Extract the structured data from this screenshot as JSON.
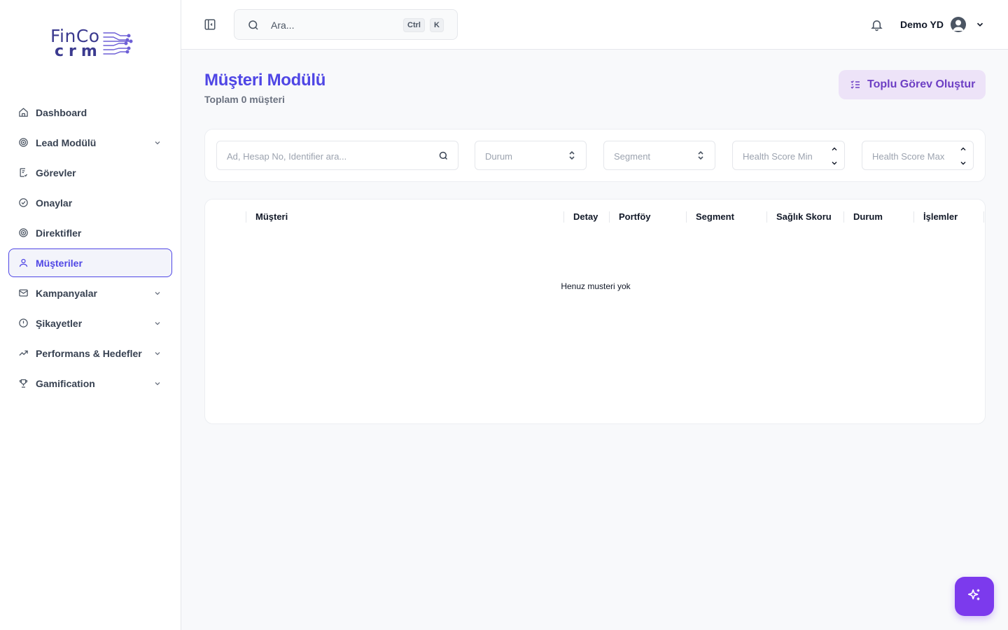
{
  "brand": {
    "line1": "FinCo",
    "line2": "crm"
  },
  "sidebar": {
    "items": [
      {
        "label": "Dashboard",
        "icon": "home-icon",
        "expandable": false,
        "active": false
      },
      {
        "label": "Lead Modülü",
        "icon": "target-icon",
        "expandable": true,
        "active": false
      },
      {
        "label": "Görevler",
        "icon": "clipboard-icon",
        "expandable": false,
        "active": false
      },
      {
        "label": "Onaylar",
        "icon": "check-circle-icon",
        "expandable": false,
        "active": false
      },
      {
        "label": "Direktifler",
        "icon": "target-icon",
        "expandable": false,
        "active": false
      },
      {
        "label": "Müşteriler",
        "icon": "user-icon",
        "expandable": false,
        "active": true
      },
      {
        "label": "Kampanyalar",
        "icon": "mail-icon",
        "expandable": true,
        "active": false
      },
      {
        "label": "Şikayetler",
        "icon": "alert-circle-icon",
        "expandable": true,
        "active": false
      },
      {
        "label": "Performans & Hedefler",
        "icon": "trending-up-icon",
        "expandable": true,
        "active": false
      },
      {
        "label": "Gamification",
        "icon": "trophy-icon",
        "expandable": true,
        "active": false
      }
    ]
  },
  "header": {
    "search_placeholder": "Ara...",
    "shortcut_ctrl": "Ctrl",
    "shortcut_k": "K",
    "user_name": "Demo YD"
  },
  "main": {
    "title": "Müşteri Modülü",
    "subtitle": "Toplam 0 müşteri",
    "bulk_button": "Toplu Görev Oluştur",
    "filters": {
      "search_placeholder": "Ad, Hesap No, Identifier ara...",
      "durum_placeholder": "Durum",
      "segment_placeholder": "Segment",
      "health_min_placeholder": "Health Score Min",
      "health_max_placeholder": "Health Score Max"
    },
    "table": {
      "columns": [
        "Müşteri",
        "Detay",
        "Portföy",
        "Segment",
        "Sağlık Skoru",
        "Durum",
        "İşlemler"
      ],
      "empty_text": "Henuz musteri yok"
    }
  },
  "colors": {
    "accent": "#4f46e5",
    "bulk_bg": "#ede3f8",
    "bulk_text": "#6d3fc4",
    "fab": "#7c3aed"
  }
}
